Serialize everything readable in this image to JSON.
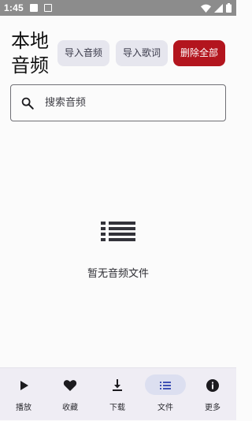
{
  "status_bar": {
    "time": "1:45"
  },
  "header": {
    "title": "本地音频",
    "import_audio_label": "导入音频",
    "import_lyrics_label": "导入歌词",
    "delete_all_label": "删除全部"
  },
  "search": {
    "placeholder": "搜索音频"
  },
  "empty_state": {
    "message": "暂无音频文件",
    "icon": "list-icon"
  },
  "bottom_nav": {
    "items": [
      {
        "label": "播放",
        "icon": "play-icon",
        "active": false
      },
      {
        "label": "收藏",
        "icon": "heart-icon",
        "active": false
      },
      {
        "label": "下载",
        "icon": "download-icon",
        "active": false
      },
      {
        "label": "文件",
        "icon": "list-icon",
        "active": true
      },
      {
        "label": "更多",
        "icon": "info-icon",
        "active": false
      }
    ]
  },
  "colors": {
    "accent_danger": "#b3151e",
    "nav_active": "#3f51b5",
    "chip_bg": "#e6e6ee",
    "nav_bg": "#efedf4"
  }
}
